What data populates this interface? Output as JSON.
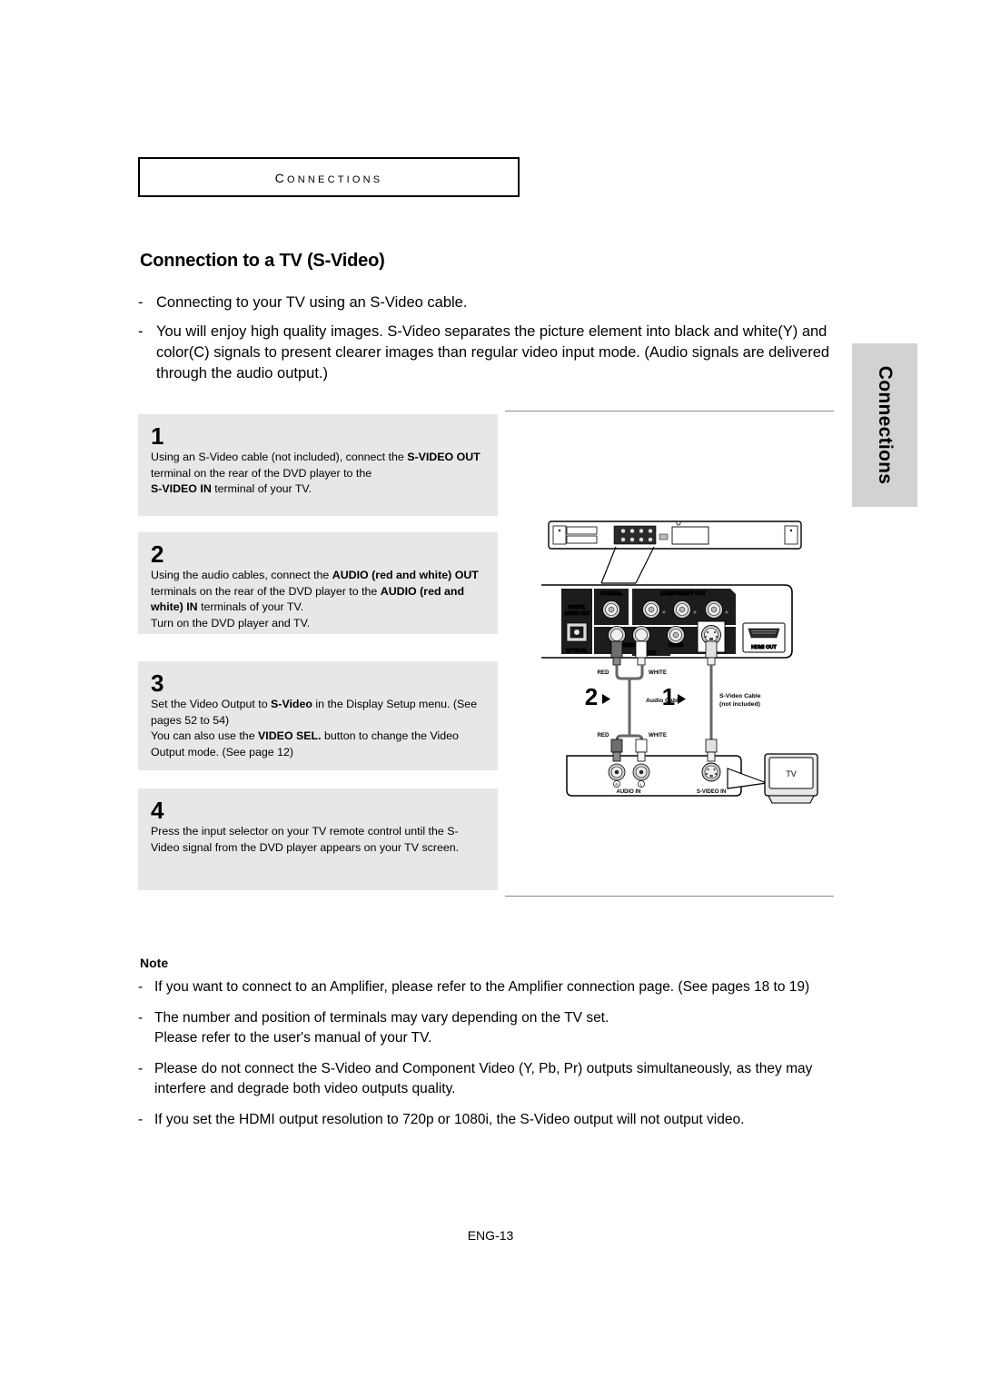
{
  "chapter": {
    "label": "Connections"
  },
  "section": {
    "title": "Connection to a TV (S-Video)"
  },
  "intro": {
    "bullet_marker": "-",
    "items": [
      "Connecting to your TV using an S-Video cable.",
      "You will enjoy high quality images. S-Video separates the picture element into black and white(Y) and color(C) signals to present clearer images than regular video input mode. (Audio signals are delivered through the audio output.)"
    ]
  },
  "steps": [
    {
      "number": "1",
      "text_html": "Using an S-Video cable (not included), connect the <b>S-VIDEO OUT</b> terminal on the rear of the DVD player to the<br><b>S-VIDEO IN</b> terminal of your TV."
    },
    {
      "number": "2",
      "text_html": "Using the audio cables, connect the <b>AUDIO (red and white) OUT</b> terminals on the rear of the DVD player to the <b>AUDIO (red and white) IN</b> terminals of your TV.<br>Turn on the DVD player and TV."
    },
    {
      "number": "3",
      "text_html": "Set the Video Output to <b>S-Video</b> in the Display Setup menu. (See pages 52 to 54)<br>You can also use the <b>VIDEO SEL.</b> button to change the Video Output mode. (See page 12)"
    },
    {
      "number": "4",
      "text_html": "Press the input selector on your TV remote control until the S-Video signal from the DVD player appears on your TV screen."
    }
  ],
  "side_tab": {
    "label": "Connections"
  },
  "note": {
    "heading": "Note",
    "bullet_marker": "-",
    "items": [
      "If you want to connect to an Amplifier, please refer to the Amplifier connection page. (See pages 18 to 19)",
      "The number and position of terminals may vary depending on the TV set.<br>Please refer to the user's manual of your TV.",
      "Please do not connect  the S-Video and Component Video (Y, Pb, Pr) outputs simultaneously, as they may interfere and degrade both video outputs quality.",
      "If you set the HDMI output resolution to 720p or 1080i, the S-Video  output will not output video."
    ]
  },
  "footer": {
    "page_label": "ENG-13"
  },
  "diagram": {
    "rear_panel_labels": {
      "digital_audio_out": "DIGITAL\nAUDIO OUT",
      "digital_audio_out_line1": "DIGITAL",
      "digital_audio_out_line2": "AUDIO OUT",
      "coaxial": "COAXIAL",
      "component_out": "COMPONENT OUT",
      "optical": "OPTICAL",
      "audio": "AUDIO",
      "video": "VIDEO",
      "s_video": "S-VIDEO",
      "out": "OUT",
      "hdmi_out": "HDMI OUT"
    },
    "cables": {
      "red_top": "RED",
      "white_top": "WHITE",
      "red_bottom": "RED",
      "white_bottom": "WHITE",
      "marker_2": "2",
      "audio_cable": "Audio Cable",
      "marker_1": "1",
      "s_video_cable_line1": "S-Video Cable",
      "s_video_cable_line2": "(not included)"
    },
    "tv_panel_labels": {
      "right_channel": "R",
      "left_channel": "L",
      "audio_in": "AUDIO IN",
      "s_video_in": "S-VIDEO IN",
      "tv": "TV"
    },
    "colors": {
      "panel_dark": "#1c1c1c",
      "panel_light": "#d9d9d9",
      "stroke": "#000000",
      "gray_mid": "#9a9a9a",
      "step_box_bg": "#e7e7e7",
      "side_tab_bg": "#d2d2d2",
      "rule": "#8a8a8a"
    }
  }
}
